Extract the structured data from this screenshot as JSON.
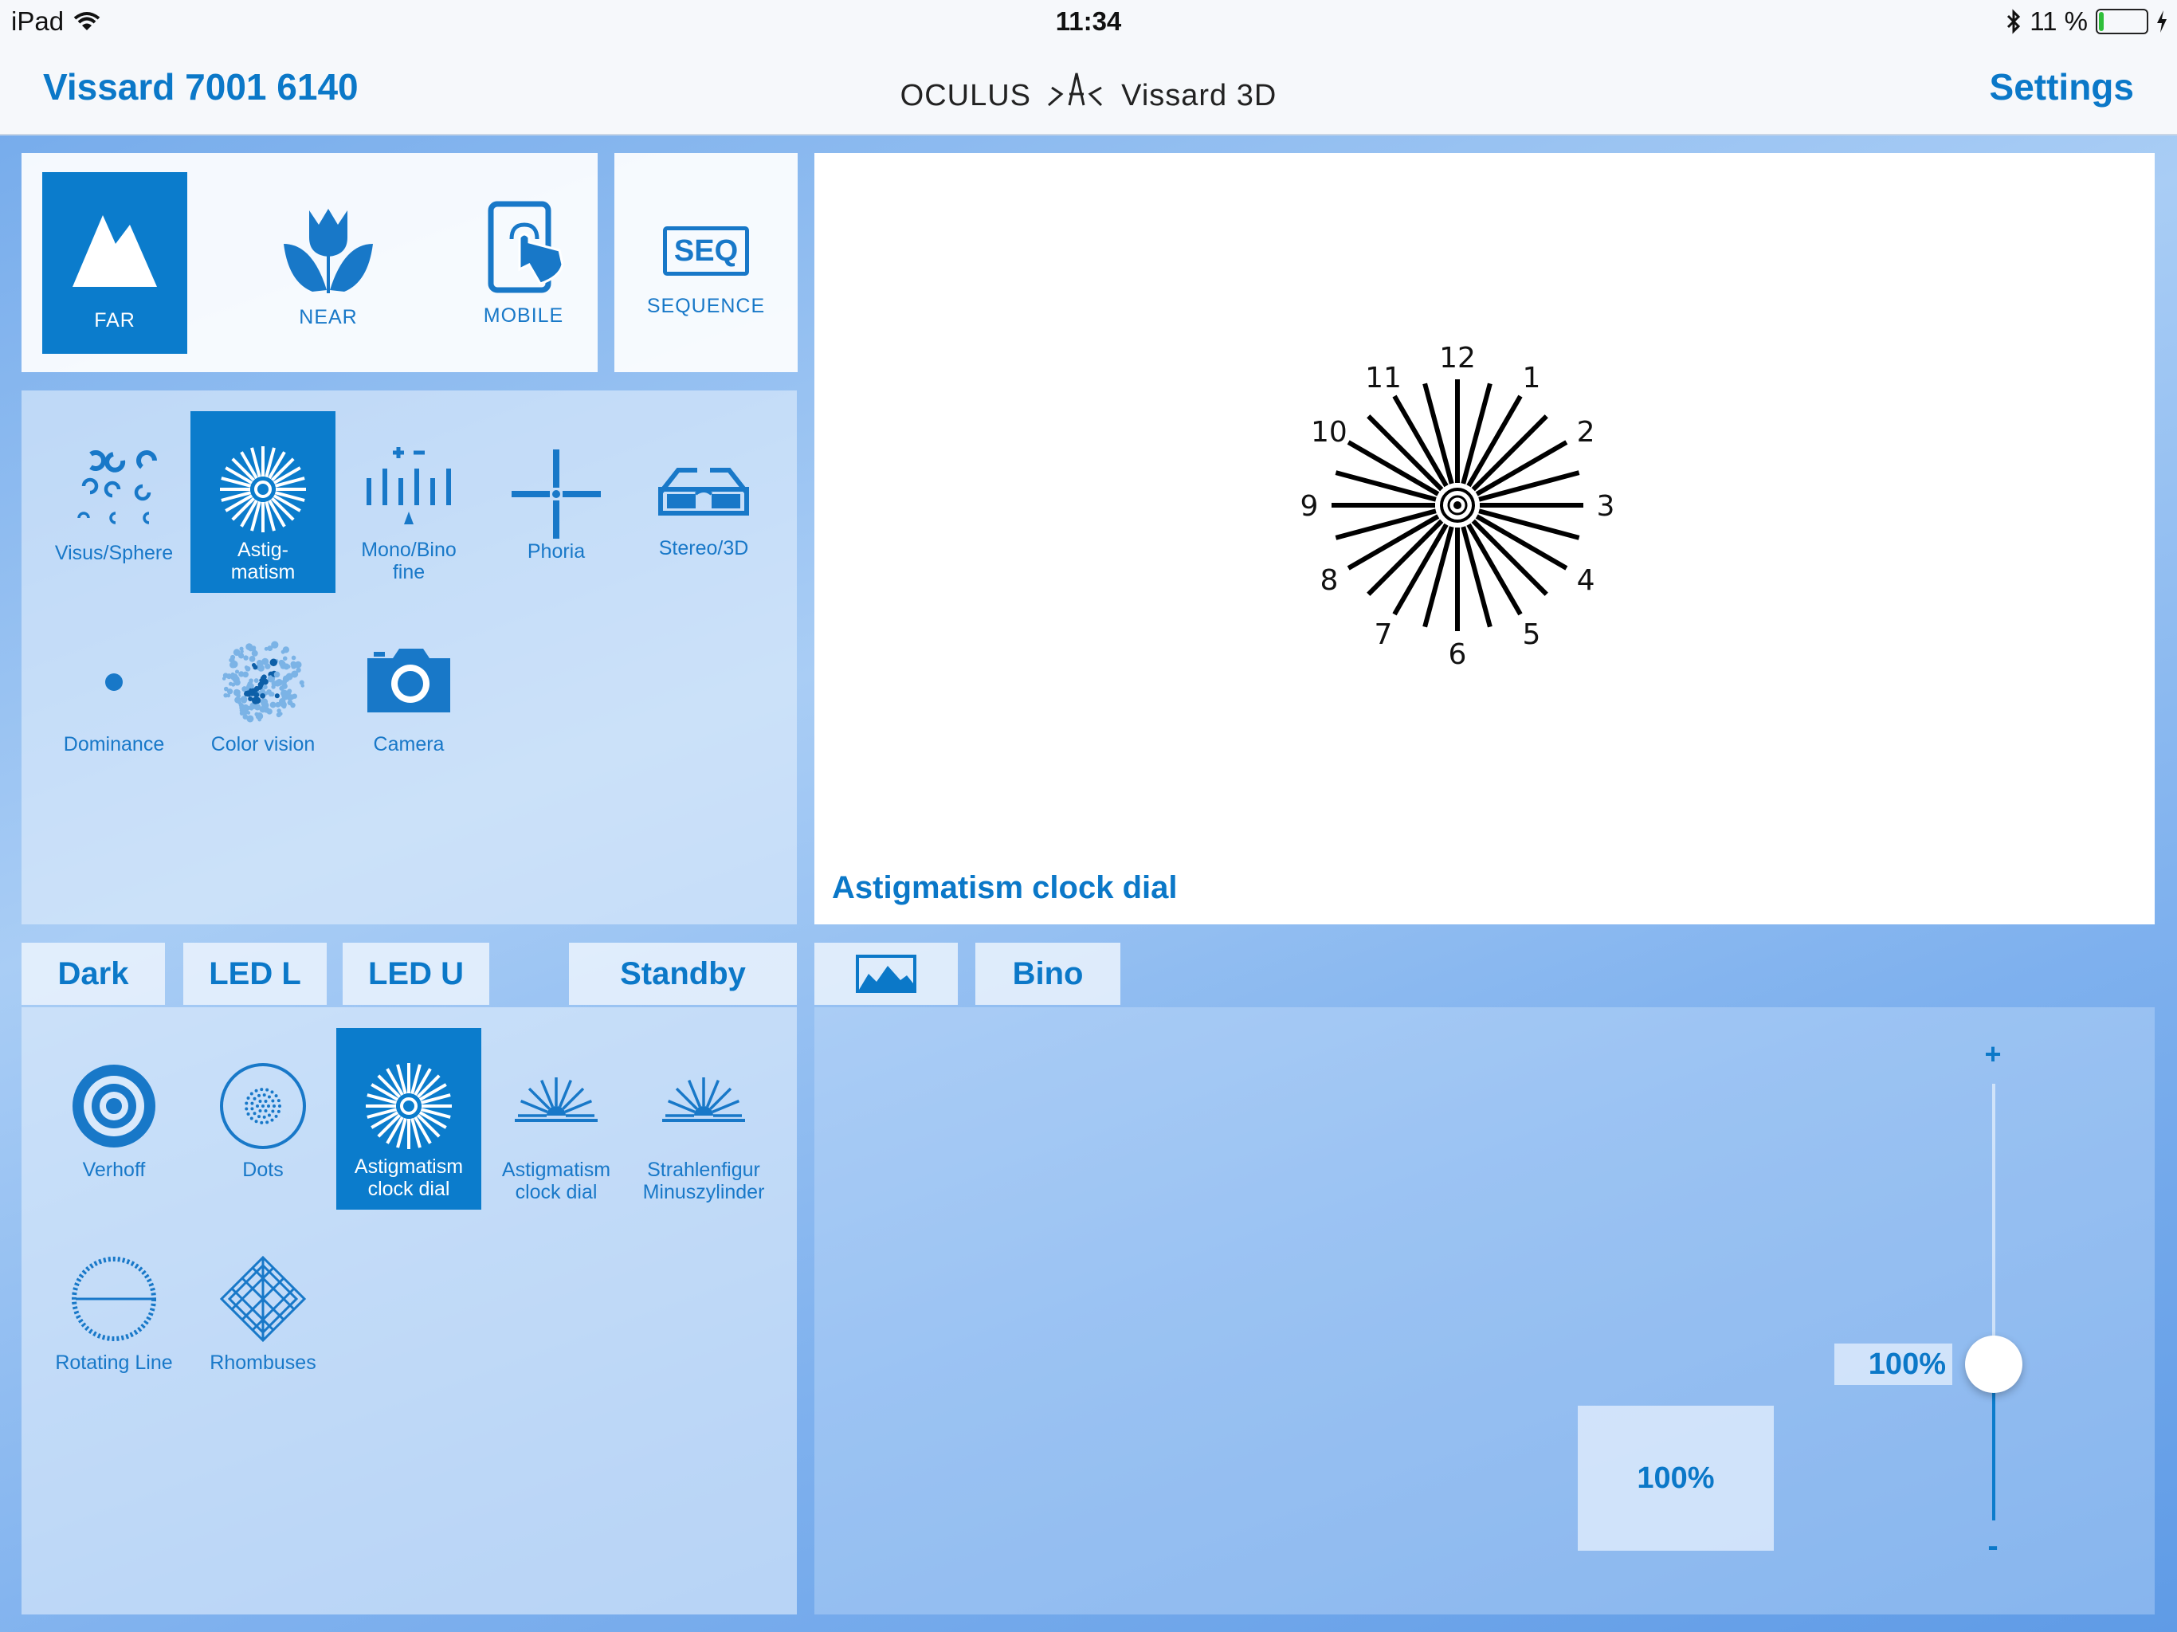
{
  "status": {
    "carrier": "iPad",
    "time": "11:34",
    "battery_text": "11 %",
    "battery_level": 0.11
  },
  "header": {
    "device": "Vissard 7001 6140",
    "brand": "OCULUS",
    "product": "Vissard 3D",
    "settings": "Settings"
  },
  "modes": {
    "items": [
      {
        "label": "FAR",
        "icon": "mountain-icon",
        "selected": true
      },
      {
        "label": "NEAR",
        "icon": "tulip-icon",
        "selected": false
      },
      {
        "label": "MOBILE",
        "icon": "mobile-touch-icon",
        "selected": false
      }
    ],
    "sequence": {
      "badge": "SEQ",
      "label": "SEQUENCE"
    }
  },
  "test_types": [
    {
      "label": "Visus/Sphere",
      "icon": "landolt-rings-icon"
    },
    {
      "label": "Astig-\nmatism",
      "icon": "starburst-icon",
      "selected": true
    },
    {
      "label": "Mono/Bino\nfine",
      "icon": "bino-lines-icon"
    },
    {
      "label": "Phoria",
      "icon": "cross-icon"
    },
    {
      "label": "Stereo/3D",
      "icon": "3d-glasses-icon"
    },
    {
      "label": "Dominance",
      "icon": "dot-icon"
    },
    {
      "label": "Color vision",
      "icon": "ishihara-icon"
    },
    {
      "label": "Camera",
      "icon": "camera-icon"
    }
  ],
  "bottom_tabs": {
    "dark": "Dark",
    "led_l": "LED L",
    "led_u": "LED U",
    "standby": "Standby"
  },
  "charts": [
    {
      "label": "Verhoff",
      "icon": "verhoff-rings-icon"
    },
    {
      "label": "Dots",
      "icon": "dots-circle-icon"
    },
    {
      "label": "Astigmatism\nclock dial",
      "icon": "starburst-icon",
      "selected": true
    },
    {
      "label": "Astigmatism\nclock dial",
      "icon": "half-fan-icon"
    },
    {
      "label": "Strahlenfigur\nMinuszylinder",
      "icon": "half-fan-icon"
    },
    {
      "label": "Rotating Line",
      "icon": "rotating-line-icon"
    },
    {
      "label": "Rhombuses",
      "icon": "rhombus-icon"
    }
  ],
  "preview": {
    "caption": "Astigmatism clock dial",
    "dial_numbers": [
      "12",
      "1",
      "2",
      "3",
      "4",
      "5",
      "6",
      "7",
      "8",
      "9",
      "10",
      "11"
    ]
  },
  "controls": {
    "bino_tab": "Bino",
    "image_icon": "image-icon",
    "slider_plus": "+",
    "slider_minus": "-",
    "slider_value_text": "100%",
    "slider_level": 1.0,
    "contrast_text": "100%"
  },
  "colors": {
    "accent": "#0b7ccc",
    "text_accent": "#0b78c8"
  }
}
